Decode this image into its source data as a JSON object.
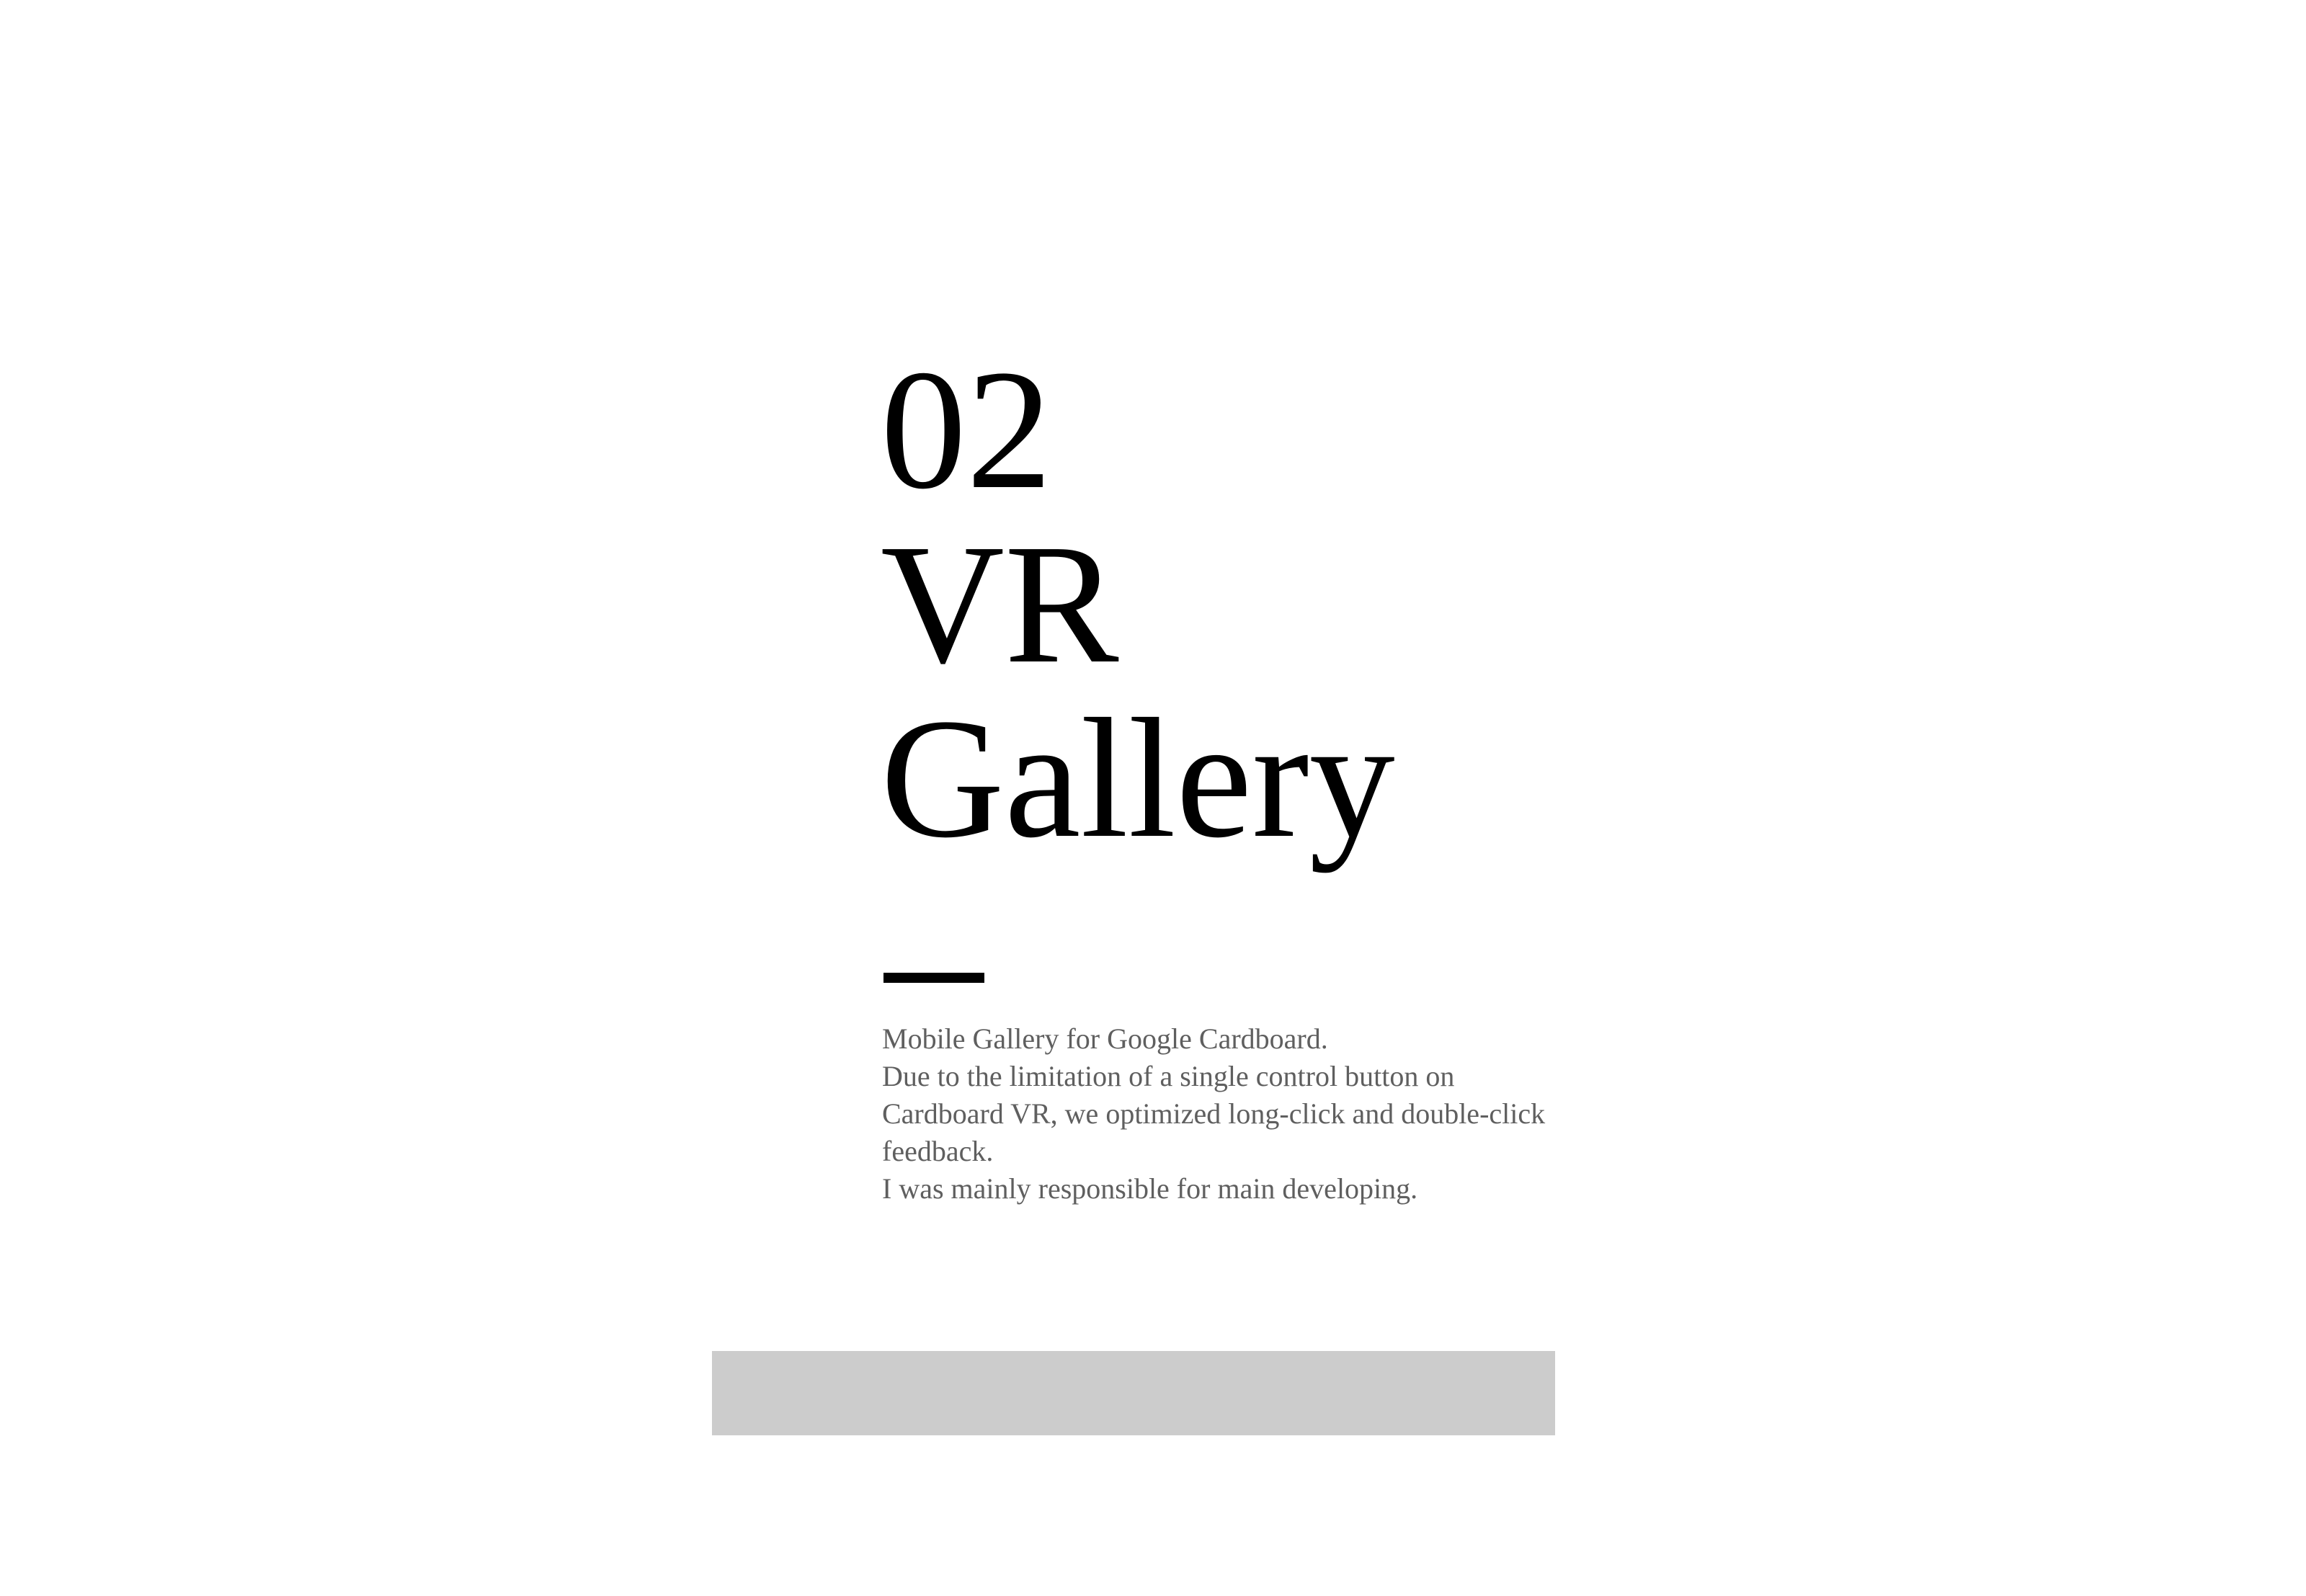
{
  "title": {
    "number": "02",
    "line1": "VR",
    "line2": "Gallery"
  },
  "description": {
    "lines": [
      "Mobile Gallery for Google Cardboard.",
      "Due to the limitation of a single control button on",
      "Cardboard VR, we optimized long-click and double-click",
      "feedback.",
      "I was mainly responsible for main developing."
    ]
  },
  "colors": {
    "title": "#000000",
    "body_text": "#5f5f5f",
    "placeholder": "#cccccc",
    "background": "#ffffff"
  }
}
